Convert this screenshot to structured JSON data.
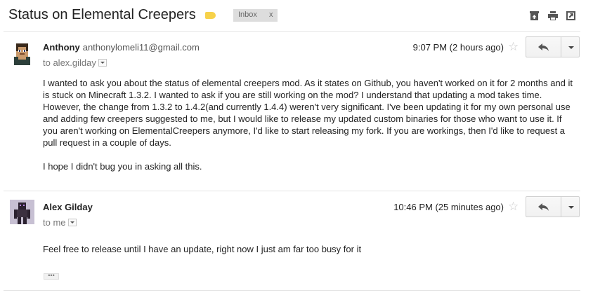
{
  "thread": {
    "subject": "Status on Elemental Creepers",
    "label": "Inbox",
    "label_remove": "x",
    "important_color": "#f7d24a",
    "header_icons": [
      "archive-icon",
      "print-icon",
      "new-window-icon"
    ]
  },
  "messages": [
    {
      "sender_name": "Anthony",
      "sender_email": "anthonylomeli11@gmail.com",
      "recipient": "to alex.gilday",
      "time": "9:07 PM (2 hours ago)",
      "body": [
        "I wanted to ask you about the status of elemental creepers mod. As it states on Github, you haven't worked on it for 2 months and it is stuck on Minecraft 1.3.2. I wanted to ask if you are still working on the mod? I understand that updating a mod takes time. However, the change from 1.3.2 to 1.4.2(and currently 1.4.4) weren't very significant. I've been updating it for my own personal use and adding few creepers suggested to me, but I would like to release my updated custom binaries for those who want to use it. If you aren't working on ElementalCreepers anymore, I'd like to start releasing my fork. If you are workings, then I'd like to request a pull request in a couple of days.",
        "I hope I didn't bug you in asking all this."
      ]
    },
    {
      "sender_name": "Alex Gilday",
      "recipient": "to me",
      "time": "10:46 PM (25 minutes ago)",
      "body": [
        "Feel free to release until I have an update, right now I just am far too busy for it"
      ],
      "trimmed_content": "•••"
    }
  ]
}
